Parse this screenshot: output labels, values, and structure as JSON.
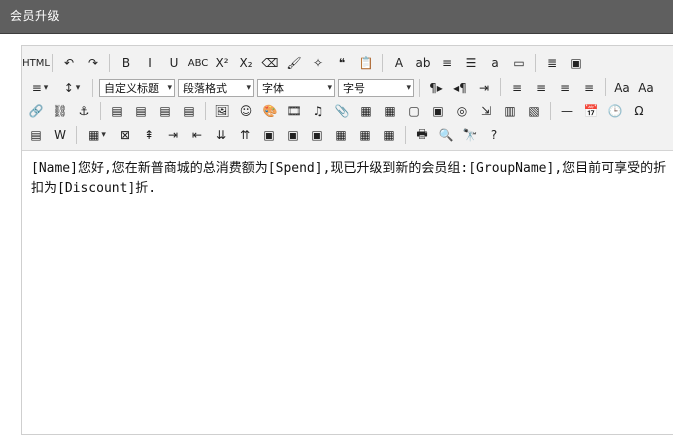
{
  "window": {
    "title": "会员升级"
  },
  "toolbar": {
    "row1": [
      {
        "name": "html-source-icon",
        "glyph": "HTML"
      },
      {
        "name": "undo-icon",
        "glyph": "↶"
      },
      {
        "name": "redo-icon",
        "glyph": "↷"
      },
      {
        "name": "bold-icon",
        "glyph": "B"
      },
      {
        "name": "italic-icon",
        "glyph": "I"
      },
      {
        "name": "underline-icon",
        "glyph": "U"
      },
      {
        "name": "strikethrough-icon",
        "glyph": "ABC"
      },
      {
        "name": "superscript-icon",
        "glyph": "X²"
      },
      {
        "name": "subscript-icon",
        "glyph": "X₂"
      },
      {
        "name": "eraser-icon",
        "glyph": "⌫"
      },
      {
        "name": "format-painter-icon",
        "glyph": "🖌"
      },
      {
        "name": "magic-wand-icon",
        "glyph": "✧"
      },
      {
        "name": "blockquote-icon",
        "glyph": "❝"
      },
      {
        "name": "paste-plain-icon",
        "glyph": "📋"
      },
      {
        "name": "font-color-icon",
        "glyph": "A"
      },
      {
        "name": "highlight-color-icon",
        "glyph": "ab"
      },
      {
        "name": "ordered-list-icon",
        "glyph": "≡"
      },
      {
        "name": "unordered-list-icon",
        "glyph": "☰"
      },
      {
        "name": "select-all-icon",
        "glyph": "a"
      },
      {
        "name": "clear-doc-icon",
        "glyph": "▭"
      },
      {
        "name": "line-height-icon",
        "glyph": "≣"
      },
      {
        "name": "preview-icon",
        "glyph": "▣"
      }
    ],
    "row2": {
      "indent_icon": "≡",
      "line_spacing_icon": "↕",
      "custom_heading": "自定义标题",
      "paragraph_format": "段落格式",
      "font_family": "字体",
      "font_size": "字号",
      "buttons": [
        {
          "name": "ltr-icon",
          "glyph": "¶▸"
        },
        {
          "name": "rtl-icon",
          "glyph": "◂¶"
        },
        {
          "name": "indent-icon",
          "glyph": "⇥"
        },
        {
          "name": "align-left-icon",
          "glyph": "≡"
        },
        {
          "name": "align-center-icon",
          "glyph": "≡"
        },
        {
          "name": "align-right-icon",
          "glyph": "≡"
        },
        {
          "name": "align-justify-icon",
          "glyph": "≡"
        },
        {
          "name": "uppercase-icon",
          "glyph": "Aa"
        },
        {
          "name": "lowercase-icon",
          "glyph": "Aa"
        }
      ]
    },
    "row3": [
      {
        "name": "link-icon",
        "glyph": "🔗"
      },
      {
        "name": "unlink-icon",
        "glyph": "⛓"
      },
      {
        "name": "anchor-icon",
        "glyph": "⚓"
      },
      {
        "name": "image-none-icon",
        "glyph": "▤"
      },
      {
        "name": "image-left-icon",
        "glyph": "▤"
      },
      {
        "name": "image-right-icon",
        "glyph": "▤"
      },
      {
        "name": "image-center-icon",
        "glyph": "▤"
      },
      {
        "name": "insert-image-icon",
        "glyph": "🖼"
      },
      {
        "name": "emotion-icon",
        "glyph": "☺"
      },
      {
        "name": "scrawl-icon",
        "glyph": "🎨"
      },
      {
        "name": "video-icon",
        "glyph": "🎞"
      },
      {
        "name": "music-icon",
        "glyph": "♫"
      },
      {
        "name": "attachment-icon",
        "glyph": "📎"
      },
      {
        "name": "map-icon",
        "glyph": "▦"
      },
      {
        "name": "google-map-icon",
        "glyph": "▦"
      },
      {
        "name": "insert-frame-icon",
        "glyph": "▢"
      },
      {
        "name": "web-app-icon",
        "glyph": "▣"
      },
      {
        "name": "code-icon",
        "glyph": "◎"
      },
      {
        "name": "page-break-icon",
        "glyph": "⇲"
      },
      {
        "name": "template-icon",
        "glyph": "▥"
      },
      {
        "name": "background-icon",
        "glyph": "▧"
      },
      {
        "name": "horizontal-line-icon",
        "glyph": "—"
      },
      {
        "name": "date-icon",
        "glyph": "📅"
      },
      {
        "name": "time-icon",
        "glyph": "🕒"
      },
      {
        "name": "special-char-icon",
        "glyph": "Ω"
      }
    ],
    "row4": [
      {
        "name": "wordimage-icon",
        "glyph": "▤"
      },
      {
        "name": "word-import-icon",
        "glyph": "W"
      },
      {
        "name": "table-icon",
        "glyph": "▦",
        "arrow": true
      },
      {
        "name": "delete-table-icon",
        "glyph": "⊠"
      },
      {
        "name": "insert-para-before-table-icon",
        "glyph": "⇞"
      },
      {
        "name": "insert-row-icon",
        "glyph": "⇥"
      },
      {
        "name": "delete-row-icon",
        "glyph": "⇤"
      },
      {
        "name": "insert-col-icon",
        "glyph": "⇊"
      },
      {
        "name": "delete-col-icon",
        "glyph": "⇈"
      },
      {
        "name": "merge-cells-icon",
        "glyph": "▣"
      },
      {
        "name": "merge-right-icon",
        "glyph": "▣"
      },
      {
        "name": "merge-down-icon",
        "glyph": "▣"
      },
      {
        "name": "split-cells-icon",
        "glyph": "▦"
      },
      {
        "name": "split-rows-icon",
        "glyph": "▦"
      },
      {
        "name": "split-cols-icon",
        "glyph": "▦"
      },
      {
        "name": "print-icon",
        "glyph": "🖶"
      },
      {
        "name": "search-replace-icon",
        "glyph": "🔍"
      },
      {
        "name": "find-icon",
        "glyph": "🔭"
      },
      {
        "name": "help-icon",
        "glyph": "?"
      }
    ]
  },
  "editor": {
    "content": "[Name]您好,您在新普商城的总消费额为[Spend],现已升级到新的会员组:[GroupName],您目前可享受的折扣为[Discount]折."
  }
}
